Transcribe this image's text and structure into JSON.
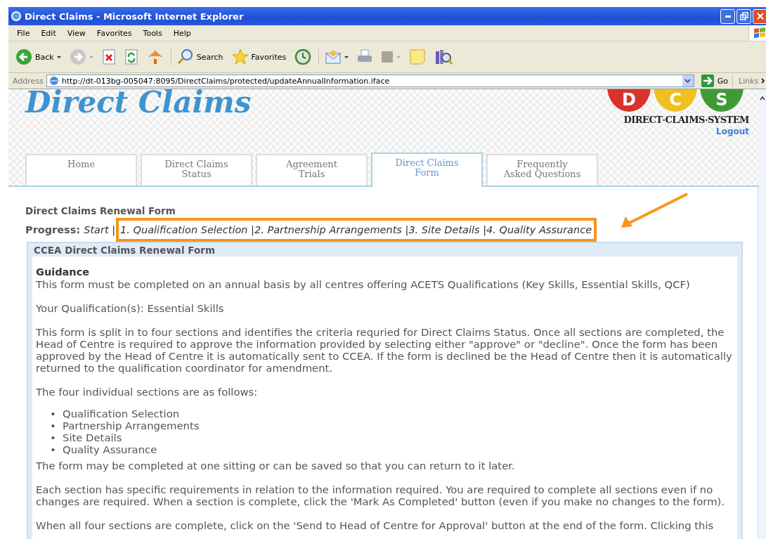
{
  "window": {
    "title": "Direct Claims - Microsoft Internet Explorer"
  },
  "menu": [
    "File",
    "Edit",
    "View",
    "Favorites",
    "Tools",
    "Help"
  ],
  "toolbar": [
    {
      "kind": "back",
      "label": "Back"
    },
    {
      "kind": "forward"
    },
    {
      "kind": "stop"
    },
    {
      "kind": "refresh"
    },
    {
      "kind": "home"
    },
    {
      "kind": "search",
      "label": "Search"
    },
    {
      "kind": "favorites",
      "label": "Favorites"
    },
    {
      "kind": "history"
    },
    {
      "kind": "mail"
    },
    {
      "kind": "print"
    },
    {
      "kind": "edit"
    },
    {
      "kind": "note"
    },
    {
      "kind": "research"
    }
  ],
  "address_bar": {
    "label": "Address",
    "value": "http://dt-013bg-005047:8095/DirectClaims/protected/updateAnnualInformation.iface",
    "go": "Go",
    "links": "Links"
  },
  "site": {
    "title": "Direct Claims",
    "logo_letters": [
      "D",
      "C",
      "S"
    ],
    "logo_text": "DIRECT·CLAIMS·SYSTEM",
    "logout": "Logout"
  },
  "tabs": [
    {
      "label": "Home",
      "selected": false
    },
    {
      "label": "Direct Claims\nStatus",
      "selected": false
    },
    {
      "label": "Agreement\nTrials",
      "selected": false
    },
    {
      "label": "Direct Claims\nForm",
      "selected": true
    },
    {
      "label": "Frequently\nAsked Questions",
      "selected": false
    }
  ],
  "form_title": "Direct Claims Renewal Form",
  "progress": {
    "label": "Progress:",
    "start": "Start |",
    "highlighted_steps": "1. Qualification Selection |2. Partnership Arrangements |3. Site Details |4. Quality Assurance"
  },
  "panel": {
    "title": "CCEA Direct Claims Renewal Form",
    "heading": "Guidance",
    "paragraphs": [
      "This form must be completed on an annual basis by all centres offering ACETS Qualifications (Key Skills, Essential Skills, QCF)",
      "Your Qualification(s): Essential Skills",
      "This form is split in to four sections and identifies the criteria requried for Direct Claims Status. Once all sections are completed, the Head of Centre is required to approve the information provided by selecting either \"approve\" or \"decline\". Once the form has been approved by the Head of Centre it is automatically sent to CCEA. If the form is declined be the Head of Centre then it is automatically returned to the qualification coordinator for amendment.",
      "The four individual sections are as follows:"
    ],
    "sections": [
      {
        "marker": "•",
        "label": "Qualification Selection"
      },
      {
        "marker": "•",
        "label": "Partnership Arrangements"
      },
      {
        "marker": "•",
        "label": "Site Details"
      },
      {
        "marker": "•",
        "label": "Quality Assurance"
      }
    ],
    "after": [
      "The form may be completed at one sitting or can be saved so that you can return to it later.",
      "Each section has specific requirements in relation to the information required. You are required to complete all sections even if no changes are required. When a section is complete, click the 'Mark As Completed' button (even if you make no changes to the form).",
      "When all four sections are complete, click on the 'Send to Head of Centre for Approval' button at the end of the form. Clicking this"
    ]
  }
}
